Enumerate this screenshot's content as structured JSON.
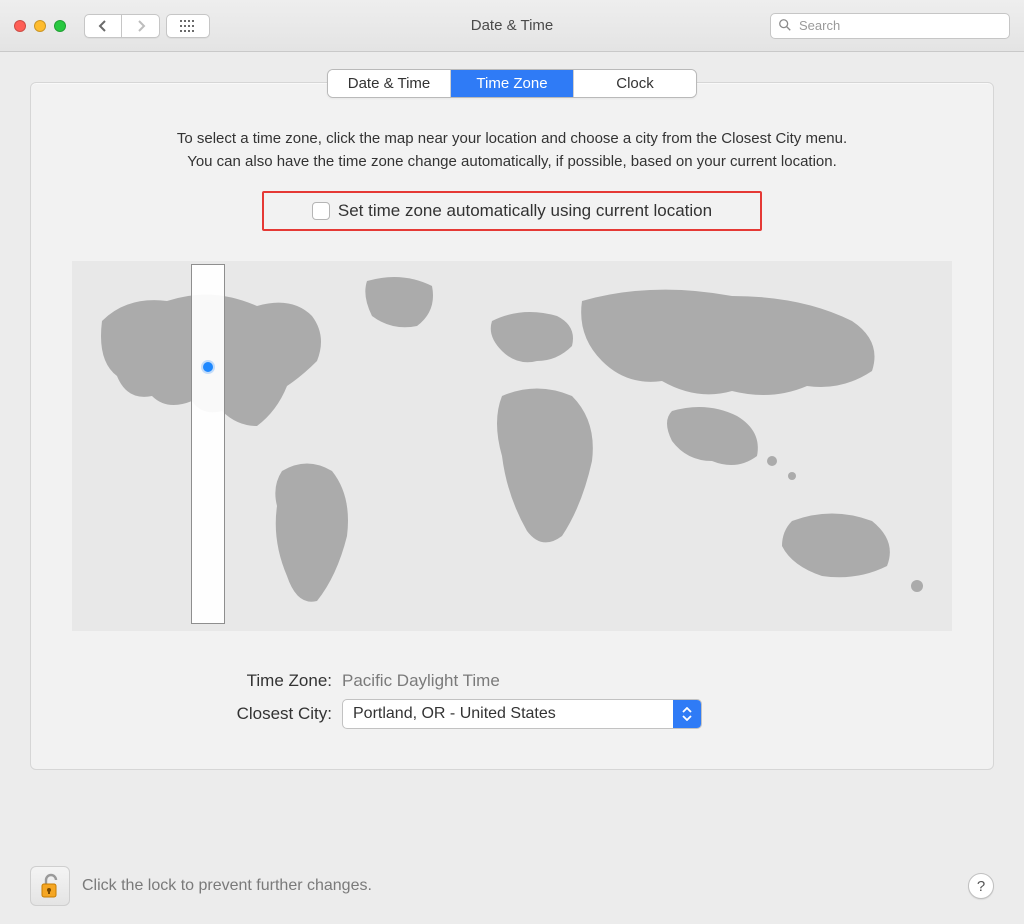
{
  "window": {
    "title": "Date & Time"
  },
  "toolbar": {
    "search_placeholder": "Search"
  },
  "tabs": {
    "items": [
      "Date & Time",
      "Time Zone",
      "Clock"
    ],
    "active_index": 1
  },
  "instructions": {
    "line1": "To select a time zone, click the map near your location and choose a city from the Closest City menu.",
    "line2": "You can also have the time zone change automatically, if possible, based on your current location."
  },
  "auto_tz": {
    "label": "Set time zone automatically using current location",
    "checked": false,
    "highlighted": true
  },
  "form": {
    "timezone_label": "Time Zone:",
    "timezone_value": "Pacific Daylight Time",
    "city_label": "Closest City:",
    "city_value": "Portland, OR - United States"
  },
  "footer": {
    "lock_text": "Click the lock to prevent further changes.",
    "help_label": "?"
  }
}
